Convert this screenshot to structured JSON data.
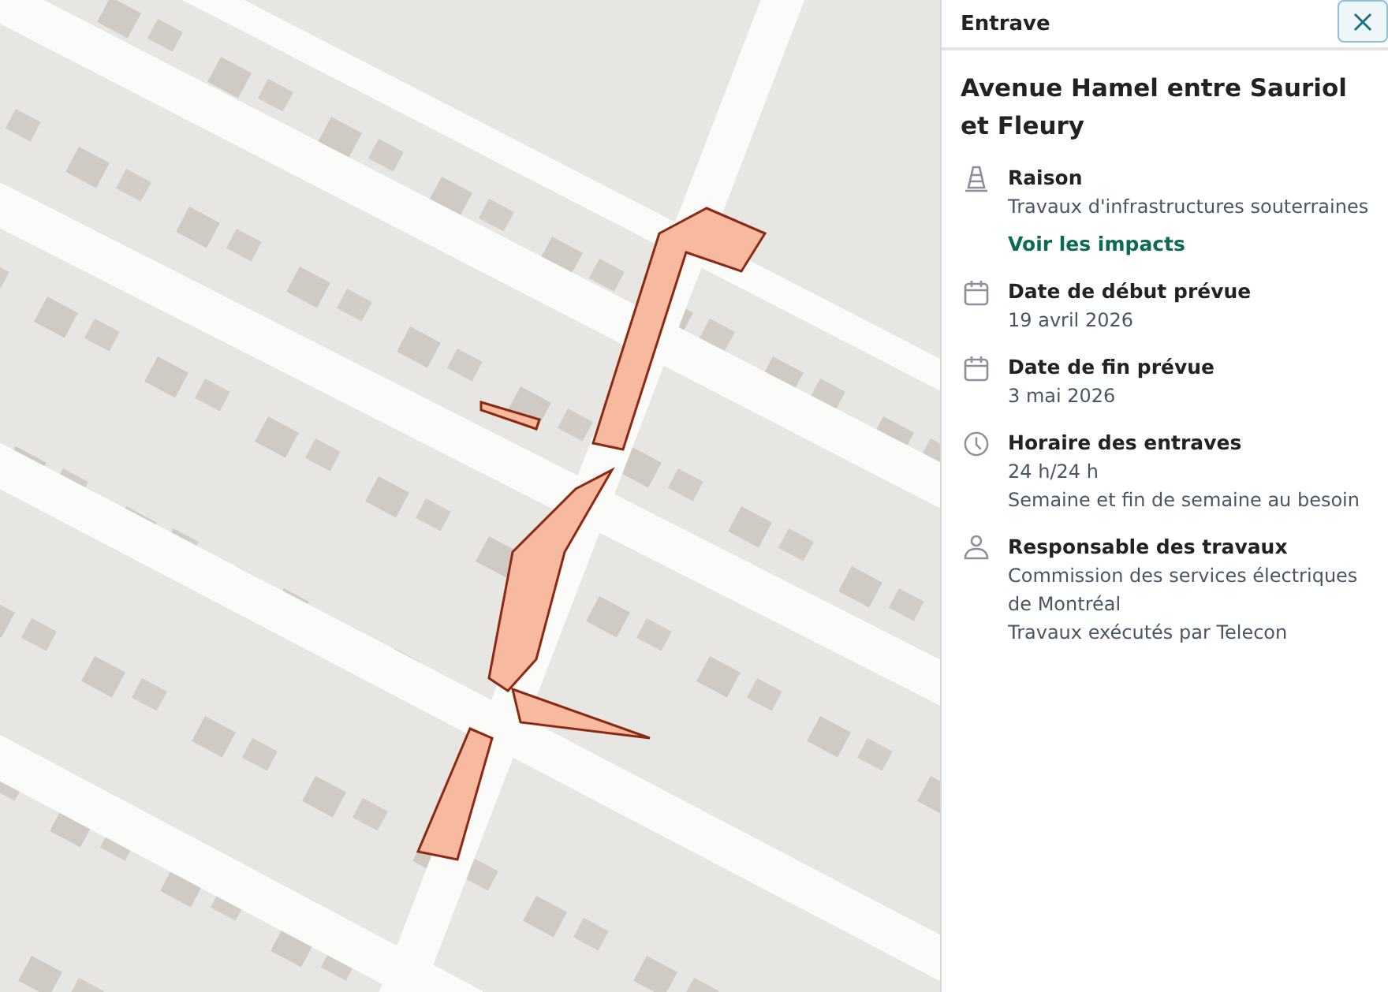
{
  "panel": {
    "header": "Entrave",
    "title": "Avenue Hamel entre Sauriol et Fleury",
    "sections": [
      {
        "kind": "reason",
        "label": "Raison",
        "lines": [
          "Travaux d'infrastructures souterraines"
        ],
        "link": "Voir les impacts"
      },
      {
        "kind": "date",
        "label": "Date de début prévue",
        "lines": [
          "19 avril 2026"
        ]
      },
      {
        "kind": "date",
        "label": "Date de fin prévue",
        "lines": [
          "3 mai 2026"
        ]
      },
      {
        "kind": "schedule",
        "label": "Horaire des entraves",
        "lines": [
          "24 h/24 h",
          "Semaine et fin de semaine au besoin"
        ]
      },
      {
        "kind": "person",
        "label": "Responsable des travaux",
        "lines": [
          "Commission des services électriques de Montréal",
          "Travaux exécutés par Telecon"
        ]
      }
    ]
  }
}
